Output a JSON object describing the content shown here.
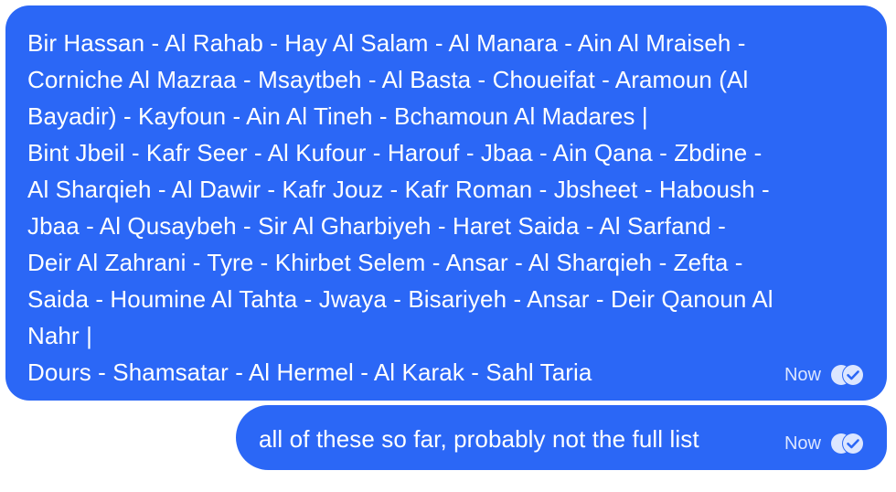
{
  "messages": [
    {
      "lines": [
        "Bir Hassan - Al Rahab - Hay Al Salam - Al Manara - Ain Al Mraiseh -",
        "Corniche Al Mazraa - Msaytbeh - Al Basta - Choueifat - Aramoun (Al",
        "Bayadir) - Kayfoun - Ain Al Tineh - Bchamoun Al Madares |",
        "Bint Jbeil - Kafr Seer - Al Kufour - Harouf - Jbaa - Ain Qana - Zbdine -",
        "Al Sharqieh - Al Dawir - Kafr Jouz - Kafr Roman - Jbsheet - Haboush -",
        "Jbaa - Al Qusaybeh - Sir Al Gharbiyeh - Haret Saida - Al Sarfand -",
        "Deir Al Zahrani - Tyre - Khirbet Selem - Ansar - Al Sharqieh - Zefta -",
        "Saida - Houmine Al Tahta - Jwaya - Bisariyeh - Ansar - Deir Qanoun Al",
        "Nahr |",
        "Dours - Shamsatar - Al Hermel - Al Karak - Sahl Taria"
      ],
      "time": "Now",
      "status_icon": "double-check-read-icon"
    },
    {
      "lines": [
        "all of these so far, probably not the full list"
      ],
      "time": "Now",
      "status_icon": "double-check-read-icon"
    }
  ],
  "colors": {
    "bubble": "#2b67f6",
    "text": "#ffffff",
    "meta": "#dce6ff"
  }
}
